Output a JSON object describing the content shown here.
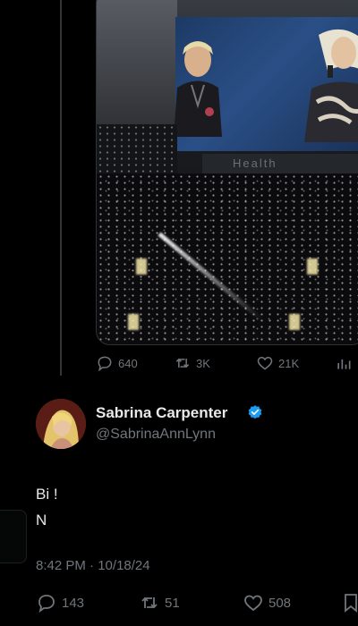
{
  "quoted_tweet": {
    "media_alt": "",
    "banner_text": "Health",
    "stats": {
      "replies": "640",
      "reposts": "3K",
      "likes": "21K"
    }
  },
  "tweet": {
    "author": {
      "display_name": "Sabrina Carpenter",
      "handle": "@SabrinaAnnLynn",
      "verified": true
    },
    "text_lines": [
      "Bi !",
      "N"
    ],
    "time": "8:42 PM",
    "separator": "·",
    "date": "10/18/24",
    "stats": {
      "replies": "143",
      "reposts": "51",
      "likes": "508"
    }
  },
  "colors": {
    "background": "#000000",
    "text_primary": "#e7e9ea",
    "text_secondary": "#71767b",
    "verified_blue": "#1d9bf0"
  },
  "icons": [
    "reply-icon",
    "repost-icon",
    "like-icon",
    "views-icon",
    "bookmark-icon",
    "verified-badge-icon"
  ]
}
